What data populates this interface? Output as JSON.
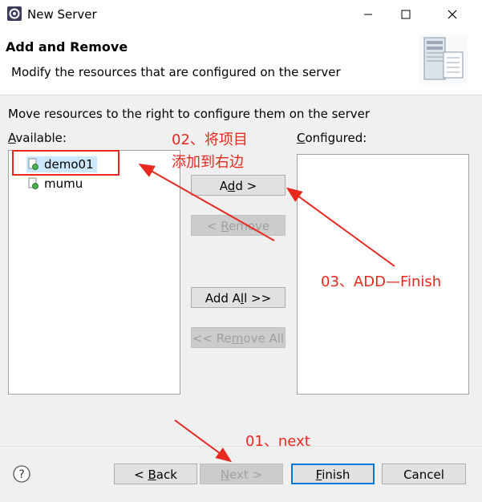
{
  "window": {
    "title": "New Server",
    "minimize_glyph": "—",
    "maximize_glyph": "☐",
    "close_glyph": "✕"
  },
  "header": {
    "title": "Add and Remove",
    "description": "Modify the resources that are configured on the server",
    "image_icon": "server-icon"
  },
  "instructions": "Move resources to the right to configure them on the server",
  "available": {
    "label_mnemonic": "A",
    "label_rest": "vailable:",
    "items": [
      {
        "label": "demo01",
        "icon": "web-project-icon",
        "selected": true
      },
      {
        "label": "mumu",
        "icon": "web-project-icon",
        "selected": false
      }
    ]
  },
  "configured": {
    "label_mnemonic": "C",
    "label_rest": "onfigured:",
    "items": []
  },
  "buttons": {
    "add": {
      "pre": "A",
      "mn": "d",
      "post": "d >"
    },
    "remove": {
      "pre": "< ",
      "mn": "R",
      "post": "emove"
    },
    "add_all": {
      "pre": "Add A",
      "mn": "l",
      "post": "l >>"
    },
    "remove_all": {
      "pre": "<< Re",
      "mn": "m",
      "post": "ove All"
    }
  },
  "footer": {
    "help_glyph": "?",
    "back": {
      "pre": "< ",
      "mn": "B",
      "post": "ack"
    },
    "next": {
      "pre": "",
      "mn": "N",
      "post": "ext >"
    },
    "finish": {
      "pre": "",
      "mn": "F",
      "post": "inish"
    },
    "cancel": "Cancel"
  },
  "annotations": {
    "step1": "01、next",
    "step2_line1": "02、将项目",
    "step2_line2": "添加到右边",
    "step3": "03、ADD—Finish",
    "color": "#e8281e"
  }
}
